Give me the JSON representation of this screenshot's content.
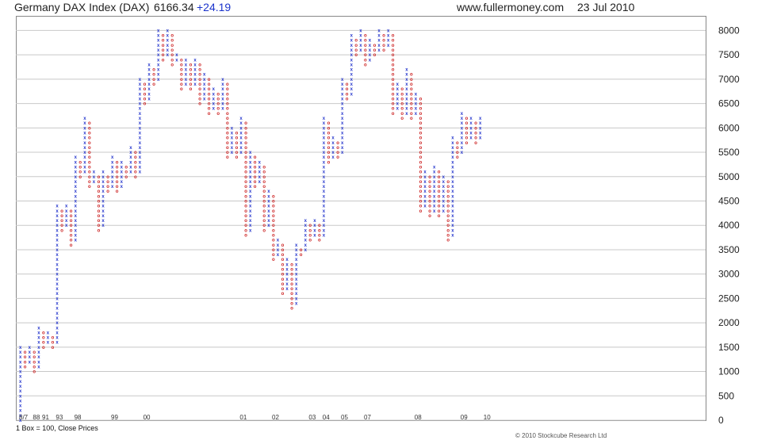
{
  "header": {
    "title": "Germany DAX Index (DAX)",
    "price": "6166.34",
    "change": "+24.19",
    "source": "www.fullermoney.com",
    "date": "23 Jul 2010"
  },
  "footer": {
    "box_note": "1 Box = 100, Close Prices",
    "copyright": "© 2010 Stockcube Research Ltd"
  },
  "colors": {
    "x_column": "#2233cc",
    "o_column": "#cc2222",
    "grid": "#c8c8c8",
    "change": "#1a33cc"
  },
  "chart_data": {
    "type": "point-and-figure",
    "title": "Germany DAX Index (DAX)",
    "box_size": 100,
    "reversal_note": "Close Prices",
    "ylim": [
      0,
      8300
    ],
    "y_ticks": [
      0,
      500,
      1000,
      1500,
      2000,
      2500,
      3000,
      3500,
      4000,
      4500,
      5000,
      5500,
      6000,
      6500,
      7000,
      7500,
      8000
    ],
    "grid": true,
    "x_axis_labels": [
      "8/7",
      "88",
      "91",
      "93",
      "98",
      "99",
      "00",
      "01",
      "02",
      "03",
      "04",
      "05",
      "07",
      "08",
      "09",
      "10"
    ],
    "columns": [
      {
        "t": "X",
        "low": 0,
        "high": 1500
      },
      {
        "t": "O",
        "low": 1100,
        "high": 1400
      },
      {
        "t": "X",
        "low": 1200,
        "high": 1500
      },
      {
        "t": "O",
        "low": 1000,
        "high": 1400
      },
      {
        "t": "X",
        "low": 1100,
        "high": 1900
      },
      {
        "t": "O",
        "low": 1500,
        "high": 1800
      },
      {
        "t": "X",
        "low": 1600,
        "high": 1800
      },
      {
        "t": "O",
        "low": 1500,
        "high": 1700
      },
      {
        "t": "X",
        "low": 1600,
        "high": 4400
      },
      {
        "t": "O",
        "low": 3900,
        "high": 4300
      },
      {
        "t": "X",
        "low": 4000,
        "high": 4400
      },
      {
        "t": "O",
        "low": 3600,
        "high": 4300
      },
      {
        "t": "X",
        "low": 3700,
        "high": 5400
      },
      {
        "t": "O",
        "low": 5000,
        "high": 5300
      },
      {
        "t": "X",
        "low": 5100,
        "high": 6200
      },
      {
        "t": "O",
        "low": 4800,
        "high": 6100
      },
      {
        "t": "X",
        "low": 4900,
        "high": 5100
      },
      {
        "t": "O",
        "low": 3900,
        "high": 5000
      },
      {
        "t": "X",
        "low": 4000,
        "high": 5100
      },
      {
        "t": "O",
        "low": 4700,
        "high": 5000
      },
      {
        "t": "X",
        "low": 4800,
        "high": 5400
      },
      {
        "t": "O",
        "low": 4700,
        "high": 5300
      },
      {
        "t": "X",
        "low": 4800,
        "high": 5300
      },
      {
        "t": "O",
        "low": 5000,
        "high": 5200
      },
      {
        "t": "X",
        "low": 5100,
        "high": 5600
      },
      {
        "t": "O",
        "low": 5000,
        "high": 5500
      },
      {
        "t": "X",
        "low": 5100,
        "high": 7000
      },
      {
        "t": "O",
        "low": 6500,
        "high": 6900
      },
      {
        "t": "X",
        "low": 6600,
        "high": 7300
      },
      {
        "t": "O",
        "low": 6900,
        "high": 7200
      },
      {
        "t": "X",
        "low": 7000,
        "high": 8000
      },
      {
        "t": "O",
        "low": 7400,
        "high": 7900
      },
      {
        "t": "X",
        "low": 7500,
        "high": 8000
      },
      {
        "t": "O",
        "low": 7300,
        "high": 7900
      },
      {
        "t": "X",
        "low": 7400,
        "high": 7500
      },
      {
        "t": "O",
        "low": 6800,
        "high": 7400
      },
      {
        "t": "X",
        "low": 6900,
        "high": 7400
      },
      {
        "t": "O",
        "low": 6800,
        "high": 7300
      },
      {
        "t": "X",
        "low": 6900,
        "high": 7400
      },
      {
        "t": "O",
        "low": 6500,
        "high": 7300
      },
      {
        "t": "X",
        "low": 6600,
        "high": 7100
      },
      {
        "t": "O",
        "low": 6300,
        "high": 7000
      },
      {
        "t": "X",
        "low": 6400,
        "high": 6800
      },
      {
        "t": "O",
        "low": 6300,
        "high": 6700
      },
      {
        "t": "X",
        "low": 6400,
        "high": 7000
      },
      {
        "t": "O",
        "low": 5400,
        "high": 6900
      },
      {
        "t": "X",
        "low": 5500,
        "high": 6000
      },
      {
        "t": "O",
        "low": 5400,
        "high": 5900
      },
      {
        "t": "X",
        "low": 5500,
        "high": 6200
      },
      {
        "t": "O",
        "low": 3800,
        "high": 6100
      },
      {
        "t": "X",
        "low": 3900,
        "high": 5500
      },
      {
        "t": "O",
        "low": 4800,
        "high": 5400
      },
      {
        "t": "X",
        "low": 4900,
        "high": 5300
      },
      {
        "t": "O",
        "low": 3900,
        "high": 5200
      },
      {
        "t": "X",
        "low": 4000,
        "high": 4700
      },
      {
        "t": "O",
        "low": 3300,
        "high": 4600
      },
      {
        "t": "X",
        "low": 3400,
        "high": 3700
      },
      {
        "t": "O",
        "low": 2600,
        "high": 3600
      },
      {
        "t": "X",
        "low": 2700,
        "high": 3300
      },
      {
        "t": "O",
        "low": 2300,
        "high": 3200
      },
      {
        "t": "X",
        "low": 2400,
        "high": 3600
      },
      {
        "t": "O",
        "low": 3400,
        "high": 3500
      },
      {
        "t": "X",
        "low": 3500,
        "high": 4100
      },
      {
        "t": "O",
        "low": 3700,
        "high": 4000
      },
      {
        "t": "X",
        "low": 3800,
        "high": 4100
      },
      {
        "t": "O",
        "low": 3700,
        "high": 4000
      },
      {
        "t": "X",
        "low": 3800,
        "high": 6200
      },
      {
        "t": "O",
        "low": 5300,
        "high": 6100
      },
      {
        "t": "X",
        "low": 5400,
        "high": 5800
      },
      {
        "t": "O",
        "low": 5400,
        "high": 5700
      },
      {
        "t": "X",
        "low": 5500,
        "high": 7000
      },
      {
        "t": "O",
        "low": 6600,
        "high": 6900
      },
      {
        "t": "X",
        "low": 6700,
        "high": 7900
      },
      {
        "t": "O",
        "low": 7500,
        "high": 7800
      },
      {
        "t": "X",
        "low": 7600,
        "high": 8000
      },
      {
        "t": "O",
        "low": 7300,
        "high": 7900
      },
      {
        "t": "X",
        "low": 7400,
        "high": 7800
      },
      {
        "t": "O",
        "low": 7500,
        "high": 7700
      },
      {
        "t": "X",
        "low": 7600,
        "high": 8000
      },
      {
        "t": "O",
        "low": 7600,
        "high": 7900
      },
      {
        "t": "X",
        "low": 7700,
        "high": 8000
      },
      {
        "t": "O",
        "low": 6300,
        "high": 7900
      },
      {
        "t": "X",
        "low": 6400,
        "high": 6900
      },
      {
        "t": "O",
        "low": 6200,
        "high": 6800
      },
      {
        "t": "X",
        "low": 6300,
        "high": 7200
      },
      {
        "t": "O",
        "low": 6200,
        "high": 7100
      },
      {
        "t": "X",
        "low": 6300,
        "high": 6700
      },
      {
        "t": "O",
        "low": 4300,
        "high": 6600
      },
      {
        "t": "X",
        "low": 4400,
        "high": 5100
      },
      {
        "t": "O",
        "low": 4200,
        "high": 5000
      },
      {
        "t": "X",
        "low": 4300,
        "high": 5200
      },
      {
        "t": "O",
        "low": 4200,
        "high": 5100
      },
      {
        "t": "X",
        "low": 4300,
        "high": 5000
      },
      {
        "t": "O",
        "low": 3700,
        "high": 4900
      },
      {
        "t": "X",
        "low": 3800,
        "high": 5800
      },
      {
        "t": "O",
        "low": 5400,
        "high": 5700
      },
      {
        "t": "X",
        "low": 5500,
        "high": 6300
      },
      {
        "t": "O",
        "low": 5700,
        "high": 6200
      },
      {
        "t": "X",
        "low": 5800,
        "high": 6200
      },
      {
        "t": "O",
        "low": 5700,
        "high": 6100
      },
      {
        "t": "X",
        "low": 5800,
        "high": 6200
      }
    ]
  }
}
